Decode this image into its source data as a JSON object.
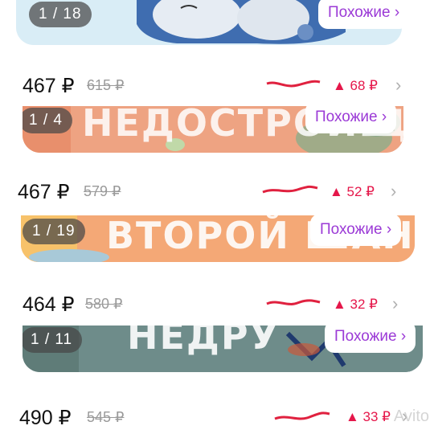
{
  "rows": [
    {
      "counter": "1 / 18",
      "similar_label": "Похожие ›",
      "price": "467 ₽",
      "old_price": "615 ₽",
      "delta": "▲ 68 ₽"
    },
    {
      "counter": "1 / 4",
      "similar_label": "Похожие ›",
      "price": "467 ₽",
      "old_price": "579 ₽",
      "delta": "▲ 52 ₽",
      "cover_text": "НЕДОСТРОЙЩ"
    },
    {
      "counter": "1 / 19",
      "similar_label": "Похожие ›",
      "price": "464 ₽",
      "old_price": "580 ₽",
      "delta": "▲ 32 ₽",
      "cover_text": "ВТОРОЙ ШАН"
    },
    {
      "counter": "1 / 11",
      "similar_label": "Похожие ›",
      "price": "490 ₽",
      "old_price": "545 ₽",
      "delta": "▲ 33 ₽",
      "cover_text": "НЕДРУ"
    }
  ],
  "chevron": "›",
  "watermark": "Avito",
  "colors": {
    "accent_purple": "#9b3ad6",
    "price_up": "#e5174a",
    "scribble": "#e0213f"
  }
}
